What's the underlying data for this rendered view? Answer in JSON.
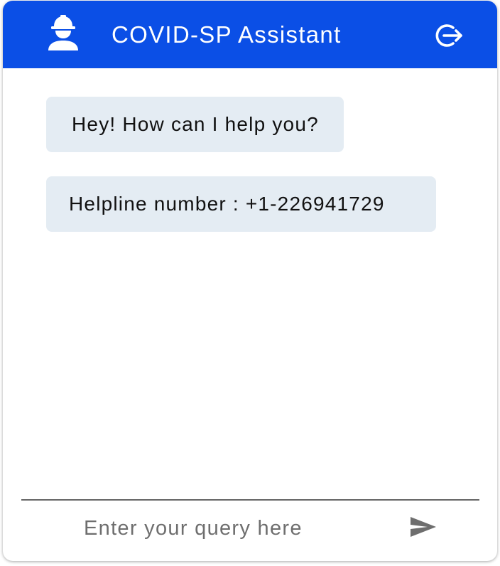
{
  "header": {
    "title": "COVID-SP Assistant",
    "background_color": "#0b4fe6",
    "agent_icon": "construction-worker-icon",
    "logout_icon": "logout-icon"
  },
  "messages": [
    {
      "sender": "bot",
      "text": "Hey! How can I help you?"
    },
    {
      "sender": "bot",
      "text": "Helpline number : +1-226941729"
    }
  ],
  "composer": {
    "value": "",
    "placeholder": "Enter your query here",
    "send_icon": "send-icon"
  }
}
